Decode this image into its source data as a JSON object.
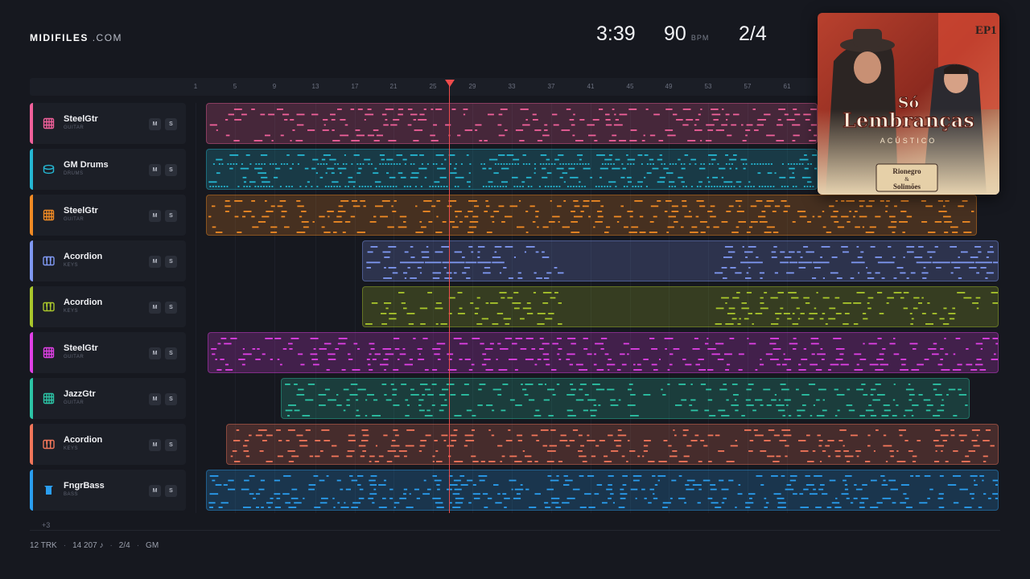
{
  "brand": {
    "name": "MIDIFILES",
    "suffix": ".COM"
  },
  "stats": {
    "time": "3:39",
    "bpm": "90",
    "bpm_unit": "BPM",
    "meter": "2/4"
  },
  "ruler": {
    "ticks": [
      "1",
      "5",
      "9",
      "13",
      "17",
      "21",
      "25",
      "29",
      "33",
      "37",
      "41",
      "45",
      "49",
      "53",
      "57",
      "61"
    ]
  },
  "tracks": [
    {
      "name": "SteelGtr",
      "category": "GUITAR",
      "color": "#f0609a",
      "icon": "guitar-icon"
    },
    {
      "name": "GM Drums",
      "category": "DRUMS",
      "color": "#25b7d3",
      "icon": "drum-icon"
    },
    {
      "name": "SteelGtr",
      "category": "GUITAR",
      "color": "#f08a24",
      "icon": "guitar-icon"
    },
    {
      "name": "Acordion",
      "category": "KEYS",
      "color": "#7f98f2",
      "icon": "piano-keys-icon"
    },
    {
      "name": "Acordion",
      "category": "KEYS",
      "color": "#a9c62b",
      "icon": "piano-keys-icon"
    },
    {
      "name": "SteelGtr",
      "category": "GUITAR",
      "color": "#e040e6",
      "icon": "guitar-icon"
    },
    {
      "name": "JazzGtr",
      "category": "GUITAR",
      "color": "#2cc4a6",
      "icon": "guitar-icon"
    },
    {
      "name": "Acordion",
      "category": "KEYS",
      "color": "#f2765a",
      "icon": "piano-keys-icon"
    },
    {
      "name": "FngrBass",
      "category": "BASS",
      "color": "#2a9ef0",
      "icon": "bass-icon"
    }
  ],
  "mute_label": "M",
  "solo_label": "S",
  "more_tracks": "+3",
  "footer": {
    "tracks": "12 TRK",
    "notes": "14 207 ♪",
    "meter": "2/4",
    "standard": "GM"
  },
  "album": {
    "badge": "EP1",
    "title_line1": "Só",
    "title_line2": "Lembranças",
    "subtitle": "ACÚSTICO",
    "artist_line1": "Rionegro",
    "artist_line2": "&",
    "artist_line3": "Solimões"
  }
}
